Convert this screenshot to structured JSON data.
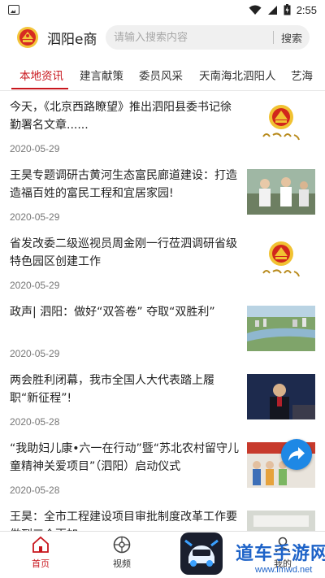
{
  "status_bar": {
    "time": "2:55"
  },
  "header": {
    "app_title": "泗阳e商",
    "search_placeholder": "请输入搜索内容",
    "search_button": "搜索"
  },
  "tabs": [
    {
      "label": "本地资讯",
      "active": true
    },
    {
      "label": "建言献策",
      "active": false
    },
    {
      "label": "委员风采",
      "active": false
    },
    {
      "label": "天南海北泗阳人",
      "active": false
    },
    {
      "label": "艺海",
      "active": false
    }
  ],
  "news": [
    {
      "title": "今天，《北京西路瞭望》推出泗阳县委书记徐勤署名文章......",
      "date": "2020-05-29",
      "thumb": "cppcc-logo"
    },
    {
      "title": "王昊专题调研古黄河生态富民廊道建设：打造造福百姓的富民工程和宜居家园!",
      "date": "2020-05-29",
      "thumb": "photo-officials"
    },
    {
      "title": "省发改委二级巡视员周金刚一行莅泗调研省级特色园区创建工作",
      "date": "2020-05-29",
      "thumb": "cppcc-logo"
    },
    {
      "title": "政声| 泗阳：做好“双答卷” 夺取“双胜利”",
      "date": "2020-05-29",
      "thumb": "photo-aerial"
    },
    {
      "title": "两会胜利闭幕，我市全国人大代表踏上履职“新征程”!",
      "date": "2020-05-28",
      "thumb": "photo-podium"
    },
    {
      "title": "“我助妇儿康•六一在行动”暨“苏北农村留守儿童精神关爱项目”（泗阳）启动仪式",
      "date": "2020-05-28",
      "thumb": "photo-children"
    },
    {
      "title": "王昊：全市工程建设项目审批制度改革工作要做到三个更加",
      "date": "",
      "thumb": "photo-meeting"
    }
  ],
  "bottom_nav": [
    {
      "label": "首页",
      "icon": "home-icon",
      "active": true
    },
    {
      "label": "视频",
      "icon": "video-icon",
      "active": false
    },
    {
      "label": "我的",
      "icon": "profile-icon",
      "active": false
    }
  ],
  "watermark": {
    "text": "道车手游网",
    "url": "www.lmwd.net"
  },
  "colors": {
    "accent": "#c8161d",
    "share": "#1e88e5",
    "watermark": "#1e63c8"
  }
}
